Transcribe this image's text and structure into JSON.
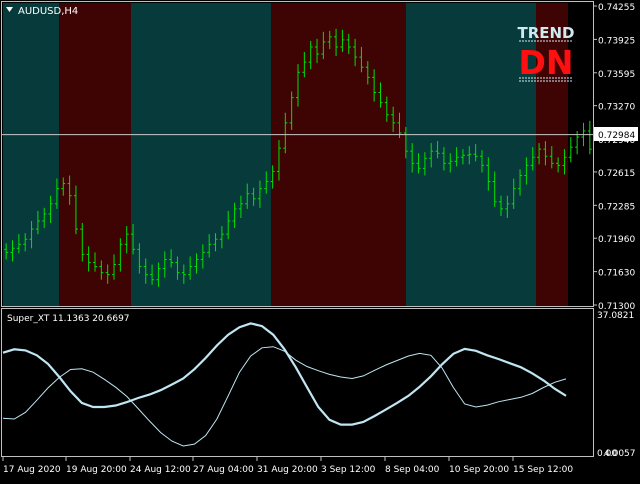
{
  "window": {
    "symbol_label": "AUDUSD,H4",
    "background": "#000000",
    "border_color": "#c0c0c0"
  },
  "trend_widget": {
    "title": "TREND",
    "direction": "DN",
    "title_color": "#d0e8f0",
    "direction_color": "#ff1010"
  },
  "price_marker": {
    "value": "0.72984",
    "line_color": "#c8c8c8",
    "label_bg": "#ffffff",
    "label_color": "#000000"
  },
  "colors": {
    "uptrend_zone": "#073b3b",
    "downtrend_zone": "#3e0404",
    "bar_color": "#00e000",
    "axis_text": "#ffffff",
    "indicator_line": "#bfe6f2"
  },
  "chart_data": [
    {
      "type": "ohlc",
      "title": "AUDUSD,H4",
      "x_tick_labels": [
        "17 Aug 2020",
        "19 Aug 20:00",
        "24 Aug 12:00",
        "27 Aug 04:00",
        "31 Aug 20:00",
        "3 Sep 12:00",
        "8 Sep 04:00",
        "10 Sep 20:00",
        "15 Sep 12:00"
      ],
      "y_tick_labels": [
        "0.74255",
        "0.73925",
        "0.73595",
        "0.73270",
        "0.72940",
        "0.72615",
        "0.72285",
        "0.71960",
        "0.71630",
        "0.71300"
      ],
      "ylim": [
        0.713,
        0.74255
      ],
      "current_price": 0.72984,
      "zones": [
        {
          "trend": "up",
          "from_bar": 0,
          "to_bar": 8
        },
        {
          "trend": "down",
          "from_bar": 9,
          "to_bar": 20
        },
        {
          "trend": "up",
          "from_bar": 21,
          "to_bar": 42
        },
        {
          "trend": "down",
          "from_bar": 43,
          "to_bar": 65
        },
        {
          "trend": "up",
          "from_bar": 66,
          "to_bar": 87
        },
        {
          "trend": "down",
          "from_bar": 88,
          "to_bar": 92
        }
      ],
      "close": [
        0.7182,
        0.7186,
        0.719,
        0.7195,
        0.7205,
        0.7213,
        0.722,
        0.723,
        0.7245,
        0.725,
        0.7238,
        0.7205,
        0.718,
        0.7172,
        0.7168,
        0.7162,
        0.716,
        0.717,
        0.719,
        0.72,
        0.7185,
        0.7168,
        0.716,
        0.7155,
        0.7166,
        0.7175,
        0.7172,
        0.7162,
        0.716,
        0.7168,
        0.7175,
        0.7182,
        0.719,
        0.7195,
        0.72,
        0.7213,
        0.7225,
        0.723,
        0.724,
        0.7235,
        0.7245,
        0.7252,
        0.7262,
        0.7285,
        0.731,
        0.7335,
        0.736,
        0.737,
        0.7385,
        0.7378,
        0.739,
        0.7395,
        0.7385,
        0.7392,
        0.7385,
        0.7375,
        0.7365,
        0.7355,
        0.734,
        0.733,
        0.7318,
        0.731,
        0.73,
        0.7282,
        0.727,
        0.7265,
        0.7275,
        0.7282,
        0.728,
        0.727,
        0.7272,
        0.7276,
        0.7278,
        0.7279,
        0.7277,
        0.7268,
        0.7252,
        0.7232,
        0.7225,
        0.723,
        0.7245,
        0.7258,
        0.7268,
        0.7276,
        0.7284,
        0.7277,
        0.727,
        0.7268,
        0.7276,
        0.7286,
        0.7296,
        0.7302,
        0.7284
      ]
    },
    {
      "type": "line",
      "title": "Super_XT 11.1363 20.6697",
      "y_tick_labels": [
        "37.0821",
        "0.00",
        "4.0057"
      ],
      "ylim": [
        0,
        37.0821
      ],
      "series": [
        {
          "name": "11.1363",
          "values": [
            26.5,
            27.4,
            27.1,
            25.8,
            23.5,
            20.0,
            16.2,
            13.1,
            12.0,
            12.0,
            12.4,
            13.3,
            14.4,
            15.3,
            16.5,
            18.0,
            19.6,
            22.1,
            25.1,
            28.4,
            31.3,
            33.3,
            34.3,
            33.6,
            31.3,
            27.4,
            22.6,
            17.3,
            12.0,
            8.6,
            7.3,
            7.3,
            8.0,
            9.6,
            11.3,
            13.1,
            15.0,
            17.4,
            20.2,
            23.4,
            26.2,
            27.5,
            27.0,
            25.8,
            24.8,
            23.7,
            22.6,
            21.0,
            19.1,
            16.9,
            15.0
          ]
        },
        {
          "name": "20.6697",
          "values": [
            9.0,
            8.8,
            10.6,
            13.8,
            17.1,
            19.9,
            22.0,
            22.2,
            21.3,
            19.4,
            17.3,
            14.8,
            11.6,
            8.3,
            5.2,
            2.9,
            1.6,
            2.1,
            4.4,
            8.8,
            15.0,
            21.3,
            25.6,
            27.8,
            28.1,
            26.9,
            24.5,
            22.8,
            21.7,
            20.7,
            20.0,
            19.6,
            20.3,
            21.8,
            23.2,
            24.4,
            25.6,
            26.3,
            25.8,
            22.4,
            17.2,
            12.8,
            12.0,
            12.5,
            13.4,
            14.0,
            14.6,
            15.6,
            17.2,
            18.6,
            19.5
          ]
        }
      ]
    }
  ]
}
